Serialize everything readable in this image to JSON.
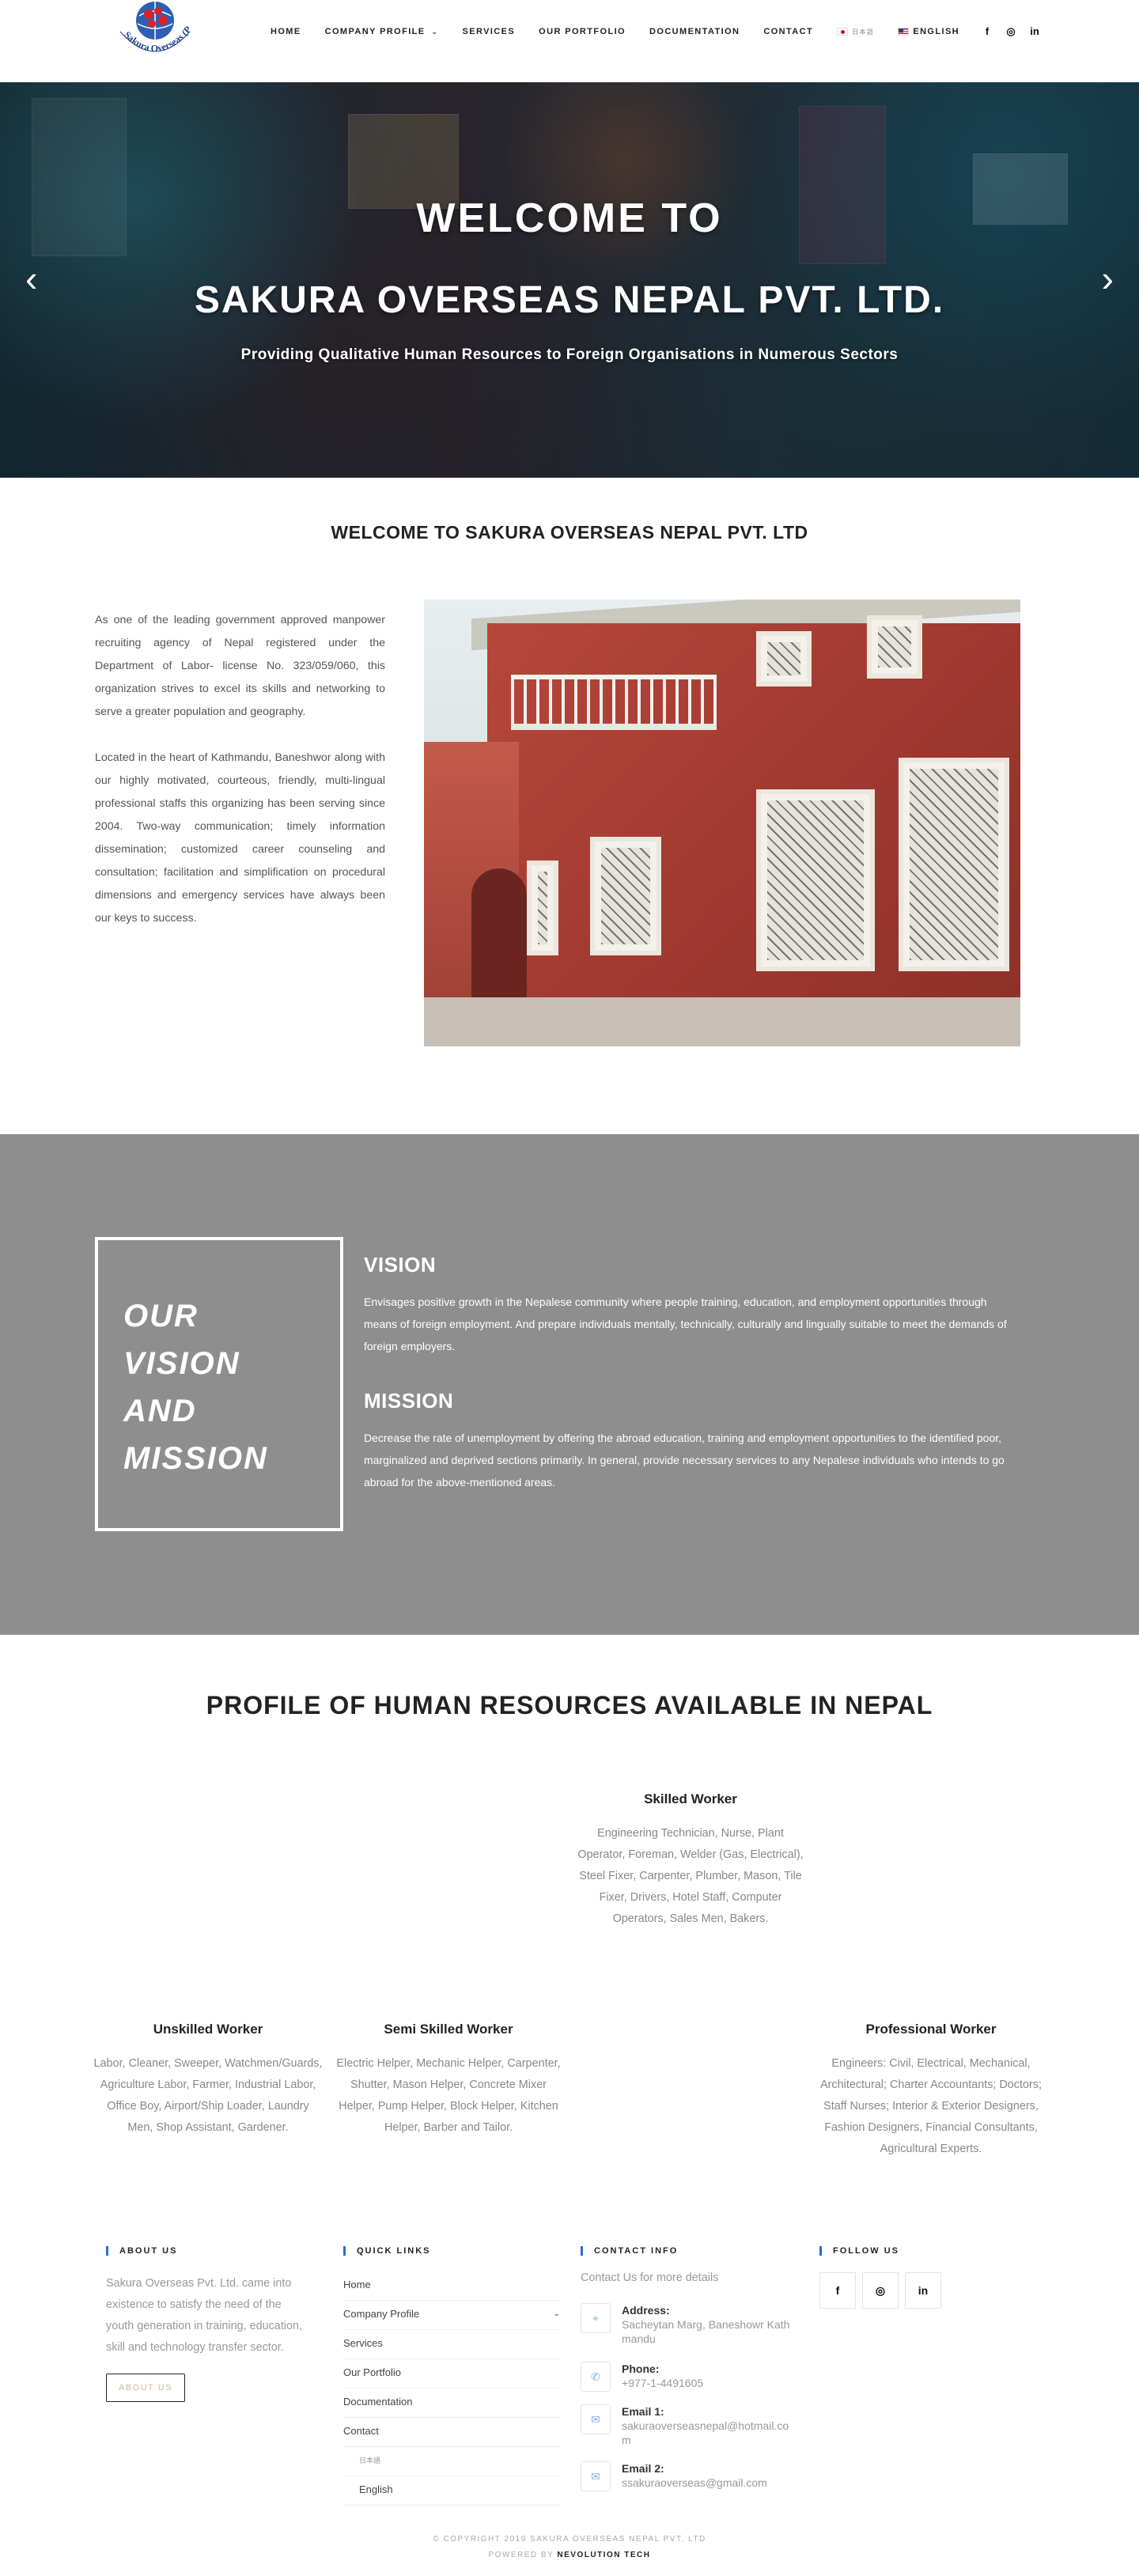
{
  "brand": {
    "logo_text": "Sakura Overseas (P.) Ltd."
  },
  "nav": {
    "items": [
      "HOME",
      "COMPANY PROFILE",
      "SERVICES",
      "OUR PORTFOLIO",
      "DOCUMENTATION",
      "CONTACT"
    ],
    "lang_jp": "日本語",
    "lang_en": "ENGLISH",
    "social_icons": [
      "facebook-icon",
      "instagram-icon",
      "linkedin-icon"
    ]
  },
  "hero": {
    "title_1": "WELCOME TO",
    "title_2": "SAKURA OVERSEAS NEPAL PVT. LTD.",
    "subtitle": "Providing Qualitative Human Resources to Foreign Organisations in Numerous Sectors",
    "prev": "‹",
    "next": "›"
  },
  "welcome": {
    "title": "WELCOME TO SAKURA OVERSEAS NEPAL PVT. LTD",
    "para_1": "As one of the leading government approved manpower recruiting agency of Nepal registered under the Department of Labor- license No. 323/059/060, this organization strives to excel its skills and networking to serve a greater population and geography.",
    "para_2": "Located in the heart of Kathmandu, Baneshwor along with our highly motivated, courteous, friendly, multi-lingual professional staffs this organizing has been serving since 2004. Two-way communication; timely information dissemination; customized career counseling and consultation; facilitation and simplification on procedural dimensions and emergency services have always been our keys to success."
  },
  "vision": {
    "box_lines": [
      "OUR",
      "VISION",
      "AND",
      "MISSION"
    ],
    "vision_title": "VISION",
    "vision_text": "Envisages positive growth in the Nepalese community where people training, education, and employment opportunities through means of foreign employment. And prepare individuals mentally, technically, culturally and lingually suitable to meet the demands of foreign employers.",
    "mission_title": "MISSION",
    "mission_text": " Decrease the rate of unemployment by offering the abroad education, training and employment opportunities to the identified poor, marginalized and deprived sections primarily. In general, provide necessary services to any Nepalese individuals who intends to go abroad for the above-mentioned areas."
  },
  "profile": {
    "title": "PROFILE OF HUMAN RESOURCES AVAILABLE IN NEPAL",
    "cards": [
      {
        "title": "Skilled Worker",
        "text": "Engineering Technician, Nurse, Plant Operator, Foreman, Welder (Gas, Electrical), Steel Fixer, Carpenter, Plumber, Mason, Tile Fixer, Drivers, Hotel Staff, Computer Operators, Sales Men, Bakers."
      },
      {
        "title": "Unskilled Worker",
        "text": "Labor, Cleaner, Sweeper, Watchmen/Guards, Agriculture Labor, Farmer, Industrial Labor, Office Boy, Airport/Ship Loader, Laundry Men, Shop Assistant, Gardener."
      },
      {
        "title": "Semi Skilled Worker",
        "text": "Electric Helper, Mechanic Helper, Carpenter, Shutter, Mason Helper, Concrete Mixer Helper, Pump Helper, Block Helper, Kitchen Helper, Barber and Tailor."
      },
      {
        "title": "Professional Worker",
        "text": "Engineers: Civil, Electrical, Mechanical, Architectural; Charter Accountants; Doctors; Staff Nurses; Interior & Exterior Designers, Fashion Designers, Financial Consultants, Agricultural Experts."
      }
    ]
  },
  "footer": {
    "about_head": "ABOUT US",
    "about_text": "Sakura Overseas Pvt. Ltd. came into existence to satisfy the need of the youth generation in training, education, skill and technology transfer sector.",
    "about_btn": "ABOUT US",
    "links_head": "QUICK LINKS",
    "links": [
      "Home",
      "Company Profile",
      "Services",
      "Our Portfolio",
      "Documentation",
      "Contact",
      "日本語",
      "English"
    ],
    "contact_head": "CONTACT INFO",
    "contact_intro": "Contact Us for more details",
    "address_label": "Address:",
    "address": "Sacheytan Marg, Baneshowr Kathmandu",
    "phone_label": "Phone:",
    "phone": "+977-1-4491605",
    "email1_label": "Email 1:",
    "email1": "sakuraoverseasnepal@hotmail.com",
    "email2_label": "Email 2:",
    "email2": "ssakuraoverseas@gmail.com",
    "follow_head": "FOLLOW US",
    "copyright": "© COPYRIGHT 2019 SAKURA OVERSEAS NEPAL PVT. LTD",
    "powered_prefix": "POWERED BY ",
    "powered_by": "NEVOLUTION TECH"
  }
}
